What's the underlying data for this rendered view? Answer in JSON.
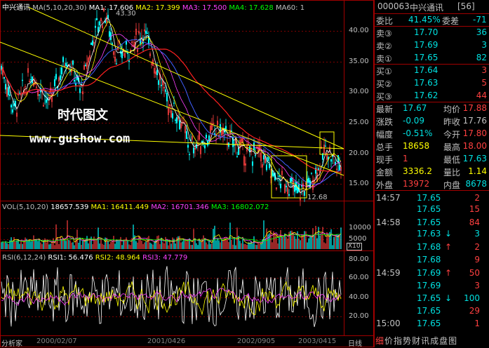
{
  "title": "中兴通讯",
  "ma_header": {
    "label": "MA(5,10,20,30)",
    "ma1": "MA1: 17.606",
    "ma2": "MA2: 17.399",
    "ma3": "MA3: 17.500",
    "ma4": "MA4: 17.628",
    "ma60": "MA60: 1"
  },
  "high_mark": "43.30",
  "low_mark": "12.68",
  "price_axis": [
    "40.00",
    "35.00",
    "30.00",
    "25.00",
    "20.00",
    "15.00"
  ],
  "watermark_cn": "时代图文",
  "watermark_url": "www.gushow.com",
  "vol_header": {
    "label": "VOL(5,10,20)",
    "value": "18657.539",
    "ma1": "MA1: 16411.449",
    "ma2": "MA2: 16701.346",
    "ma3": "MA3: 16802.072"
  },
  "vol_axis": [
    "10000",
    "5000"
  ],
  "vol_unit": "X10",
  "rsi_header": {
    "label": "RSI(6,12,24)",
    "rsi1": "RSI1: 56.476",
    "rsi2": "RSI2: 48.964",
    "rsi3": "RSI3: 47.779"
  },
  "rsi_axis": [
    "80.00",
    "60.00",
    "40.00",
    "20.00"
  ],
  "bottom": {
    "left": "分析家",
    "dates": [
      "2000/02/07",
      "2001/0426",
      "2002/0905",
      "2003/0415"
    ],
    "right": "日线"
  },
  "quote": {
    "code": "000063",
    "name": "中兴通讯",
    "count": "[56]",
    "weibi_label": "委比",
    "weibi_value": "41.45%",
    "weicha_label": "委差",
    "weicha_value": "-71",
    "asks": [
      {
        "label": "卖③",
        "price": "17.70",
        "vol": "36"
      },
      {
        "label": "卖②",
        "price": "17.69",
        "vol": "3"
      },
      {
        "label": "卖①",
        "price": "17.65",
        "vol": "82"
      }
    ],
    "bids": [
      {
        "label": "买①",
        "price": "17.64",
        "vol": "3"
      },
      {
        "label": "买②",
        "price": "17.63",
        "vol": "5"
      },
      {
        "label": "买③",
        "price": "17.62",
        "vol": "44"
      }
    ],
    "stats": [
      {
        "l1": "最新",
        "v1": "17.67",
        "l2": "均价",
        "v2": "17.88"
      },
      {
        "l1": "涨跌",
        "v1": "-0.09",
        "l2": "昨收",
        "v2": "17.76"
      },
      {
        "l1": "幅度",
        "v1": "-0.51%",
        "l2": "今开",
        "v2": "17.80"
      },
      {
        "l1": "总手",
        "v1": "18658",
        "l2": "最高",
        "v2": "18.00"
      },
      {
        "l1": "现手",
        "v1": "1",
        "l2": "最低",
        "v2": "17.63"
      },
      {
        "l1": "金额",
        "v1": "3336.2",
        "l2": "量比",
        "v2": "1.14"
      },
      {
        "l1": "外盘",
        "v1": "13972",
        "l2": "内盘",
        "v2": "8678"
      }
    ]
  },
  "ticks": [
    {
      "time": "14:57",
      "price": "17.65",
      "arrow": "",
      "vol": "2"
    },
    {
      "time": "",
      "price": "17.65",
      "arrow": "",
      "vol": "15"
    },
    {
      "time": "14:58",
      "price": "17.65",
      "arrow": "",
      "vol": "84"
    },
    {
      "time": "",
      "price": "17.63",
      "arrow": "↓",
      "vol": "3"
    },
    {
      "time": "",
      "price": "17.68",
      "arrow": "↑",
      "vol": "2"
    },
    {
      "time": "",
      "price": "17.68",
      "arrow": "",
      "vol": "9"
    },
    {
      "time": "14:59",
      "price": "17.69",
      "arrow": "↑",
      "vol": "50"
    },
    {
      "time": "",
      "price": "17.69",
      "arrow": "",
      "vol": "3"
    },
    {
      "time": "",
      "price": "17.65",
      "arrow": "↓",
      "vol": "100"
    },
    {
      "time": "",
      "price": "17.65",
      "arrow": "",
      "vol": "29"
    },
    {
      "time": "15:00",
      "price": "17.65",
      "arrow": "",
      "vol": "1"
    }
  ],
  "tabs": [
    "细",
    "价",
    "指",
    "势",
    "财",
    "讯",
    "成",
    "盘",
    "图"
  ],
  "colors": {
    "red": "#ff4040",
    "green": "#00e0e0",
    "yellow": "#ffff00",
    "white": "#ffffff",
    "magenta": "#ff40ff",
    "cyan": "#00ffff",
    "grid": "#a00000"
  }
}
